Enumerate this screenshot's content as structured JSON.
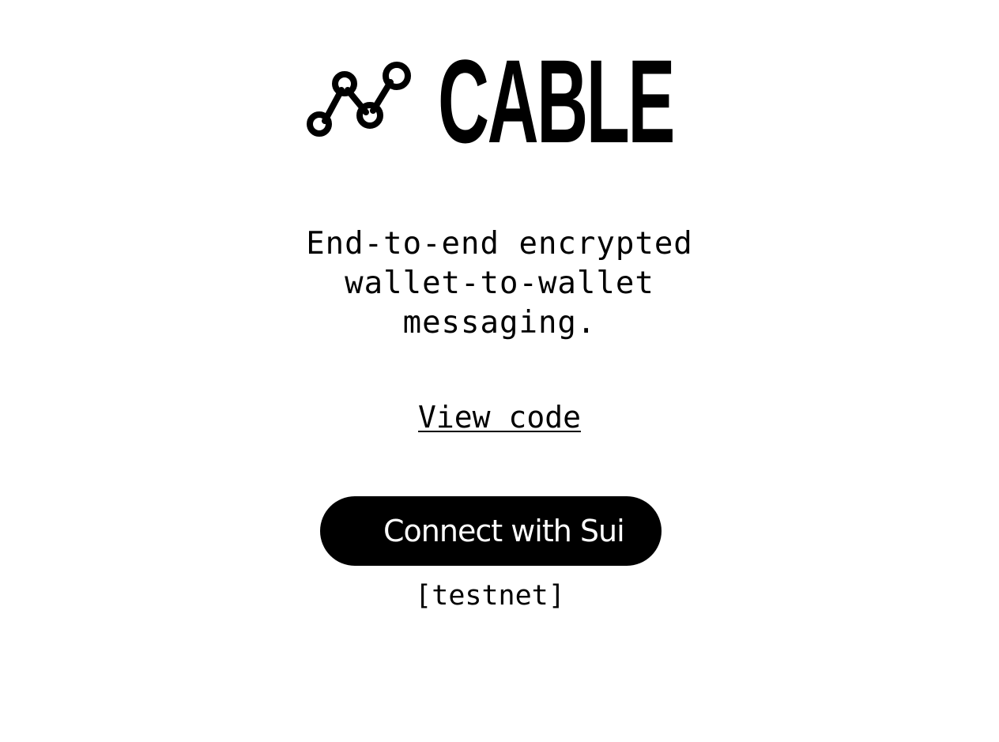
{
  "logo": {
    "icon": "connected-nodes-icon",
    "text": "CABLE"
  },
  "tagline": {
    "lines": [
      "End-to-end encrypted",
      "wallet-to-wallet",
      "messaging."
    ]
  },
  "links": {
    "view_code": "View code"
  },
  "connect": {
    "label": "Connect with Sui"
  },
  "network": {
    "label": "[testnet]"
  },
  "colors": {
    "background": "#ffffff",
    "foreground": "#000000",
    "button_text": "#ffffff"
  }
}
